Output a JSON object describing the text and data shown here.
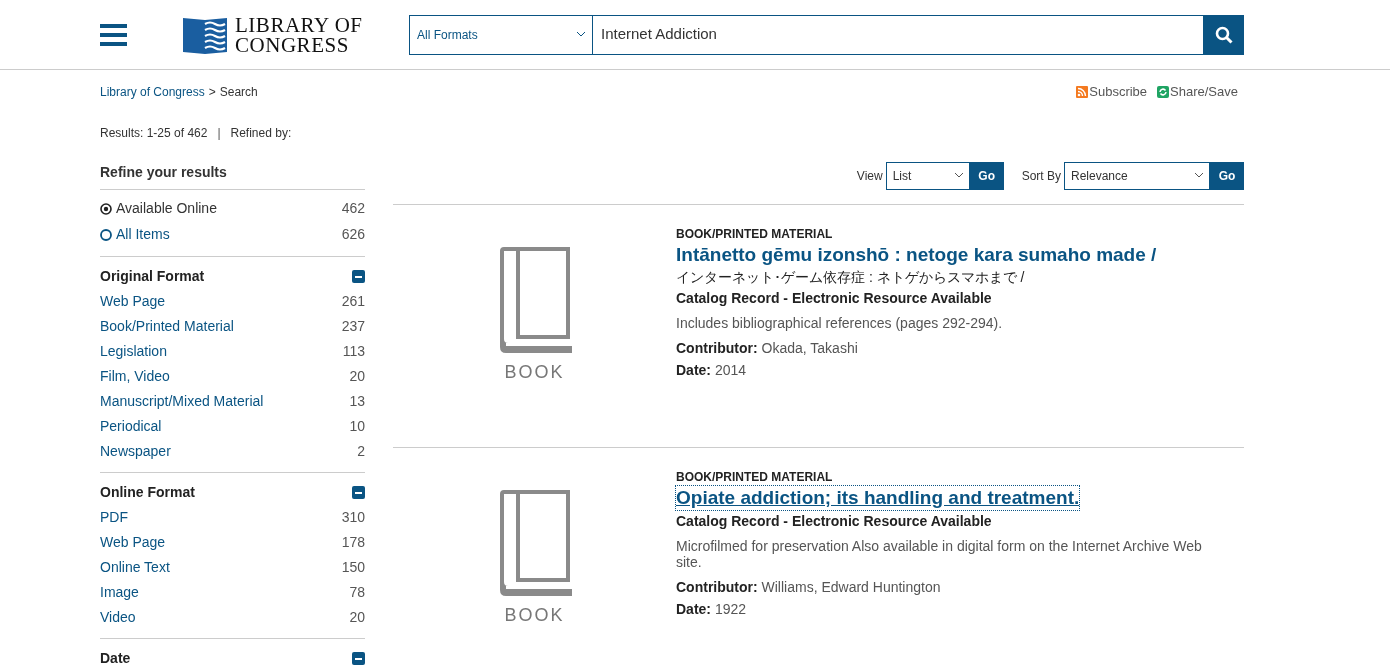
{
  "header": {
    "logo_lines": [
      "LIBRARY OF",
      "CONGRESS"
    ],
    "format_select": "All Formats",
    "search_value": "Internet Addiction"
  },
  "breadcrumb": [
    "Library of Congress",
    "Search"
  ],
  "breadcrumb_separator": ">",
  "actions": [
    {
      "kind": "rss",
      "label": "Subscribe"
    },
    {
      "kind": "share",
      "label": "Share/Save"
    }
  ],
  "results_summary": {
    "range": "Results: 1-25 of 462",
    "separator": "|",
    "refined": "Refined by:"
  },
  "view": {
    "label": "View",
    "value": "List",
    "button": "Go"
  },
  "sort": {
    "label": "Sort By",
    "value": "Relevance",
    "button": "Go"
  },
  "sidebar": {
    "title": "Refine your results",
    "availability": [
      {
        "label": "Available Online",
        "count": "462",
        "selected": true
      },
      {
        "label": "All Items",
        "count": "626",
        "selected": false
      }
    ],
    "sections": [
      {
        "title": "Original Format",
        "expanded": true,
        "items": [
          {
            "label": "Web Page",
            "count": "261"
          },
          {
            "label": "Book/Printed Material",
            "count": "237"
          },
          {
            "label": "Legislation",
            "count": "113"
          },
          {
            "label": "Film, Video",
            "count": "20"
          },
          {
            "label": "Manuscript/Mixed Material",
            "count": "13"
          },
          {
            "label": "Periodical",
            "count": "10"
          },
          {
            "label": "Newspaper",
            "count": "2"
          }
        ]
      },
      {
        "title": "Online Format",
        "expanded": true,
        "items": [
          {
            "label": "PDF",
            "count": "310"
          },
          {
            "label": "Web Page",
            "count": "178"
          },
          {
            "label": "Online Text",
            "count": "150"
          },
          {
            "label": "Image",
            "count": "78"
          },
          {
            "label": "Video",
            "count": "20"
          }
        ]
      },
      {
        "title": "Date",
        "expanded": true
      }
    ]
  },
  "results": [
    {
      "thumbnail_label": "BOOK",
      "format": "BOOK/PRINTED MATERIAL",
      "title": "Intānetto gēmu izonshō : netoge kara sumaho made /",
      "focused": false,
      "subtitle": "インターネット･ゲーム依存症 : ネトゲからスマホまで /",
      "record": "Catalog Record - Electronic Resource Available",
      "description": "Includes bibliographical references (pages 292-294).",
      "fields": [
        {
          "label": "Contributor:",
          "value": "Okada, Takashi"
        },
        {
          "label": "Date:",
          "value": "2014"
        }
      ]
    },
    {
      "thumbnail_label": "BOOK",
      "format": "BOOK/PRINTED MATERIAL",
      "title": "Opiate addiction; its handling and treatment.",
      "focused": true,
      "record": "Catalog Record - Electronic Resource Available",
      "description": "Microfilmed for preservation Also available in digital form on the Internet Archive Web site.",
      "fields": [
        {
          "label": "Contributor:",
          "value": "Williams, Edward Huntington"
        },
        {
          "label": "Date:",
          "value": "1922"
        }
      ]
    }
  ]
}
